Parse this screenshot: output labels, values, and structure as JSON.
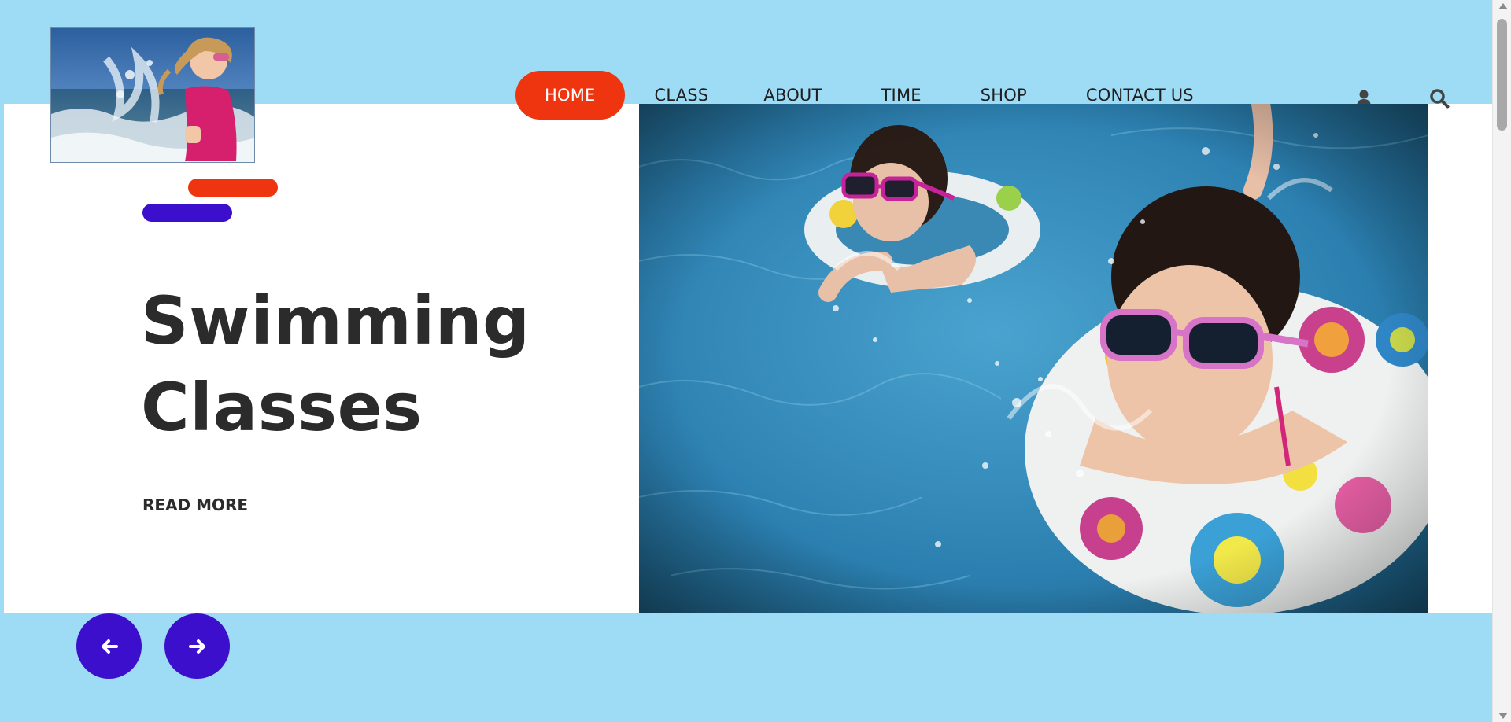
{
  "header": {
    "logo_alt": "Girl splashing in the sea"
  },
  "nav": {
    "items": [
      {
        "label": "HOME",
        "active": true
      },
      {
        "label": "CLASS",
        "active": false
      },
      {
        "label": "ABOUT",
        "active": false
      },
      {
        "label": "TIME",
        "active": false
      },
      {
        "label": "SHOP",
        "active": false
      },
      {
        "label": "CONTACT US",
        "active": false
      }
    ],
    "icons": [
      "user-icon",
      "search-icon"
    ]
  },
  "hero": {
    "title_line1": "Swimming",
    "title_line2": "Classes",
    "read_more": "READ MORE",
    "image_alt": "Two children swimming with inflatable rings and pink sunglasses"
  },
  "slider": {
    "prev_icon": "arrow-left-icon",
    "next_icon": "arrow-right-icon"
  },
  "colors": {
    "band": "#9edcf6",
    "accent_orange": "#ee3510",
    "accent_purple": "#3c0fcc",
    "text_dark": "#2b2b2b"
  }
}
